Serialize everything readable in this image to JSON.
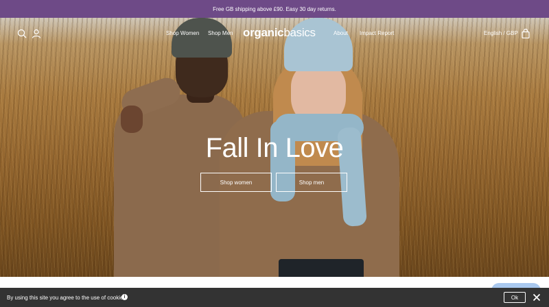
{
  "announcement": {
    "text": "Free GB shipping above £90. Easy 30 day returns."
  },
  "nav": {
    "links_left": [
      "Shop Women",
      "Shop Men"
    ],
    "logo_bold": "organic",
    "logo_light": "basics",
    "links_right": [
      "About",
      "Impact Report"
    ],
    "locale": "English / GBP",
    "icons": [
      "search-icon",
      "account-icon",
      "cart-icon"
    ]
  },
  "hero": {
    "title": "Fall In Love",
    "buttons": [
      "Shop women",
      "Shop men"
    ],
    "slides": {
      "count": 3,
      "active": 1
    }
  },
  "cookie": {
    "text": "By using this site you agree to the use of cookies.",
    "info_icon": "i",
    "ok_label": "Ok",
    "icons": [
      "info-icon",
      "close-icon"
    ]
  },
  "colors": {
    "announcement_bg": "#6e4a87",
    "cookie_bg": "#333333",
    "chat_bubble": "#a9c8ee"
  }
}
